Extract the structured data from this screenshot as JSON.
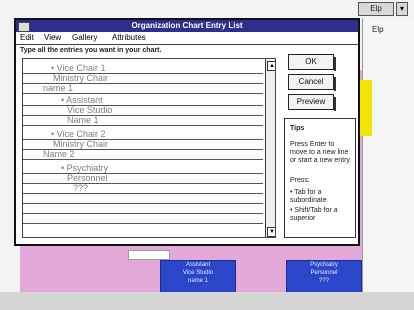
{
  "window": {
    "title": "Organization Chart Entry List",
    "menu": [
      "Edit",
      "View",
      "Gallery",
      "Attributes"
    ],
    "instruction": "Type all the entries you want in your chart."
  },
  "background": {
    "top_right_button": "Elp",
    "side_menu_label": "Elp",
    "boxes": [
      {
        "lines": [
          "Assistant",
          "Vice Studio",
          "name 1"
        ]
      },
      {
        "lines": [
          "Psychiatry",
          "Personnel",
          "???"
        ]
      }
    ]
  },
  "entries": [
    "• Vice Chair 1",
    "Ministry Chair",
    "name 1",
    "• Assistant",
    "Vice Studio",
    "Name 1",
    "• Vice Chair 2",
    "Ministry Chair",
    "Name 2",
    "• Psychiatry",
    "Personnel",
    "???"
  ],
  "buttons": {
    "ok": "OK",
    "cancel": "Cancel",
    "preview": "Preview"
  },
  "tips": {
    "heading": "Tips",
    "p1": "Press Enter to move to a new line or start a new entry.",
    "p2": "Press:",
    "bullets": [
      "• Tab for a subordinate",
      "• Shift/Tab for a superior"
    ]
  }
}
